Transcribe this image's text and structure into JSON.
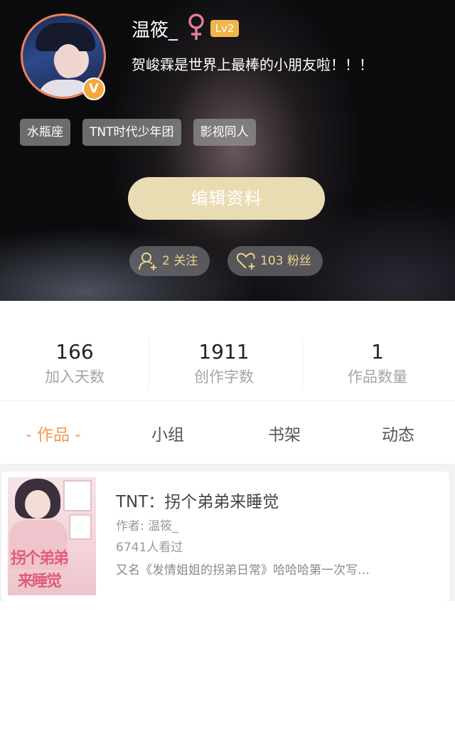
{
  "profile": {
    "username": "温筱_",
    "level": "Lv2",
    "verified_mark": "V",
    "motto": "贺峻霖是世界上最棒的小朋友啦！！！",
    "tags": [
      "水瓶座",
      "TNT时代少年团",
      "影视同人"
    ],
    "edit_button": "编辑资料",
    "follow": "2 关注",
    "fans": "103 粉丝"
  },
  "stats": [
    {
      "value": "166",
      "label": "加入天数"
    },
    {
      "value": "1911",
      "label": "创作字数"
    },
    {
      "value": "1",
      "label": "作品数量"
    }
  ],
  "tabs": [
    {
      "label": "- 作品 -",
      "active": true
    },
    {
      "label": "小组",
      "active": false
    },
    {
      "label": "书架",
      "active": false
    },
    {
      "label": "动态",
      "active": false
    }
  ],
  "works": [
    {
      "title": "TNT：拐个弟弟来睡觉",
      "author": "作者: 温筱_",
      "views": "6741人看过",
      "description": "又名《发情姐姐的拐弟日常》哈哈哈第一次写…",
      "cover_title_line1": "拐个弟弟",
      "cover_title_line2": "来睡觉"
    }
  ],
  "colors": {
    "accent": "#f09a5a",
    "edit_button": "#e9dcb3",
    "pill_text": "#efd28a",
    "level_badge": "#f0b54a",
    "gender_icon": "#e37d9a"
  },
  "icons": {
    "gender": "female-symbol-icon",
    "follow": "user-add-icon",
    "fans": "heart-add-icon",
    "verified": "verified-v-icon"
  }
}
